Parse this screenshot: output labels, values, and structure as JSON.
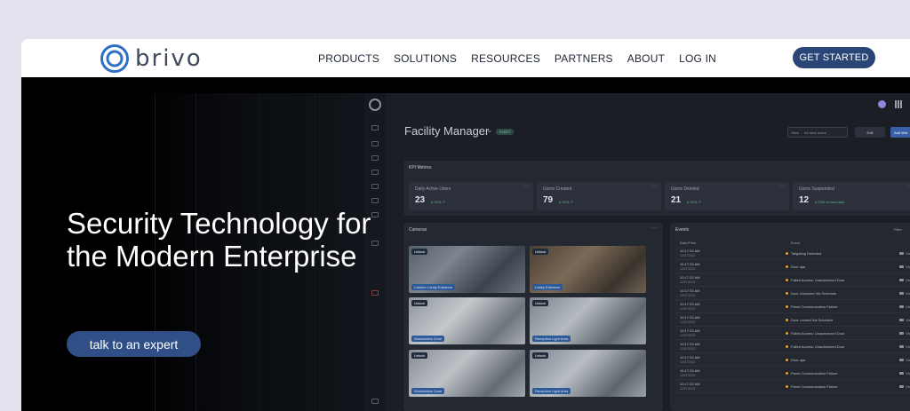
{
  "brand": {
    "name": "brivo",
    "color": "#2f6fc4"
  },
  "nav": {
    "items": [
      "PRODUCTS",
      "SOLUTIONS",
      "RESOURCES",
      "PARTNERS",
      "ABOUT",
      "LOG IN"
    ],
    "cta": "GET STARTED"
  },
  "hero": {
    "headline_line1": "Security Technology for",
    "headline_line2": "the Modern Enterprise",
    "button": "talk to an expert"
  },
  "dashboard": {
    "title": "Facility Manager",
    "badge": "FLEET",
    "site_select_label": "Sites",
    "site_select_value": "All sites active",
    "edit_label": "Edit",
    "add_label": "Add Wid",
    "kpi_title": "KPI Metrics",
    "kpis": [
      {
        "label": "Daily Active Users",
        "value": "23",
        "delta": "0.42% ↗"
      },
      {
        "label": "Users Created",
        "value": "79",
        "delta": "0.42% ↗"
      },
      {
        "label": "Users Deleted",
        "value": "21",
        "delta": "0.42% ↗"
      },
      {
        "label": "Users Suspended",
        "value": "12",
        "delta": "0.23% of total user"
      }
    ],
    "cameras_title": "Cameras",
    "cameras": [
      {
        "status": "Unlock",
        "name": "Cashier Lobby Entrance"
      },
      {
        "status": "Unlock",
        "name": "Lobby Entrance"
      },
      {
        "status": "Unlock",
        "name": "Workstation Zone"
      },
      {
        "status": "Unlock",
        "name": "Reception Light Area"
      },
      {
        "status": "Unlock",
        "name": "Workstation Zone"
      },
      {
        "status": "Unlock",
        "name": "Reception Light Area"
      }
    ],
    "events_title": "Events",
    "events_filter": "Filter",
    "events_col_time": "Date/Time",
    "events_col_event": "Event",
    "events": [
      {
        "time": "10:17:33 AM",
        "date": "12/07/2022",
        "event": "Tailgating Detected",
        "view": "View"
      },
      {
        "time": "10:17:33 AM",
        "date": "12/07/2022",
        "event": "Door ajar",
        "view": "View"
      },
      {
        "time": "10:17:33 AM",
        "date": "12/07/2022",
        "event": "Failed Access: Unauthorized Door",
        "view": "View"
      },
      {
        "time": "10:17:33 AM",
        "date": "12/07/2022",
        "event": "Door Unlocked Via Schedule",
        "view": "View"
      },
      {
        "time": "10:17:33 AM",
        "date": "12/07/2022",
        "event": "Panel Communication Failure",
        "view": "View"
      },
      {
        "time": "10:17:33 AM",
        "date": "12/07/2022",
        "event": "Door Locked Via Schedule",
        "view": "View"
      },
      {
        "time": "10:17:33 AM",
        "date": "12/07/2022",
        "event": "Failed Access: Unauthorized Door",
        "view": "View"
      },
      {
        "time": "10:17:33 AM",
        "date": "12/07/2022",
        "event": "Failed Access: Unauthorized Door",
        "view": "View"
      },
      {
        "time": "10:17:33 AM",
        "date": "12/07/2022",
        "event": "Door ajar",
        "view": "View"
      },
      {
        "time": "10:17:33 AM",
        "date": "12/07/2022",
        "event": "Panel Communication Failure",
        "view": "View"
      },
      {
        "time": "10:17:33 AM",
        "date": "12/07/2022",
        "event": "Panel Communication Failure",
        "view": "View"
      }
    ]
  }
}
